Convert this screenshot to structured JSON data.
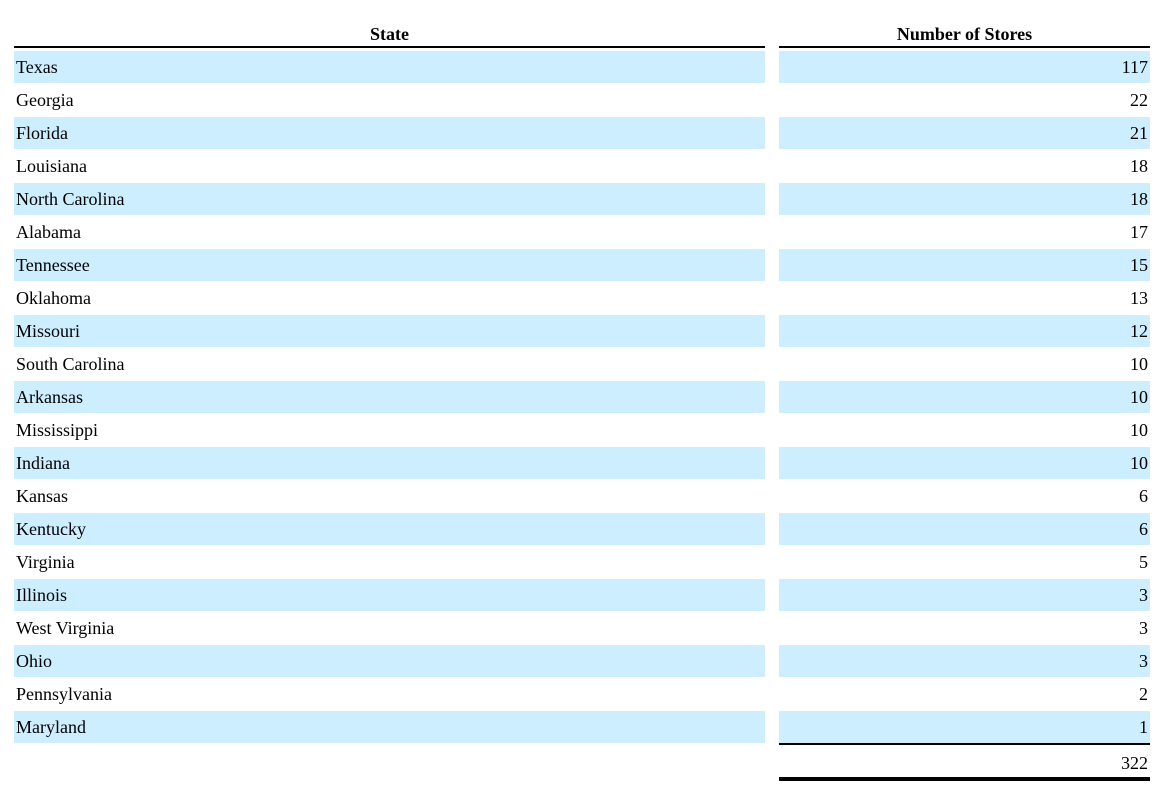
{
  "table": {
    "headers": {
      "state": "State",
      "stores": "Number of Stores"
    },
    "rows": [
      {
        "state": "Texas",
        "stores": "117"
      },
      {
        "state": "Georgia",
        "stores": "22"
      },
      {
        "state": "Florida",
        "stores": "21"
      },
      {
        "state": "Louisiana",
        "stores": "18"
      },
      {
        "state": "North Carolina",
        "stores": "18"
      },
      {
        "state": "Alabama",
        "stores": "17"
      },
      {
        "state": "Tennessee",
        "stores": "15"
      },
      {
        "state": "Oklahoma",
        "stores": "13"
      },
      {
        "state": "Missouri",
        "stores": "12"
      },
      {
        "state": "South Carolina",
        "stores": "10"
      },
      {
        "state": "Arkansas",
        "stores": "10"
      },
      {
        "state": "Mississippi",
        "stores": "10"
      },
      {
        "state": "Indiana",
        "stores": "10"
      },
      {
        "state": "Kansas",
        "stores": "6"
      },
      {
        "state": "Kentucky",
        "stores": "6"
      },
      {
        "state": "Virginia",
        "stores": "5"
      },
      {
        "state": "Illinois",
        "stores": "3"
      },
      {
        "state": "West Virginia",
        "stores": "3"
      },
      {
        "state": "Ohio",
        "stores": "3"
      },
      {
        "state": "Pennsylvania",
        "stores": "2"
      },
      {
        "state": "Maryland",
        "stores": "1"
      }
    ],
    "total": "322",
    "shade_color": "#cceeff"
  }
}
